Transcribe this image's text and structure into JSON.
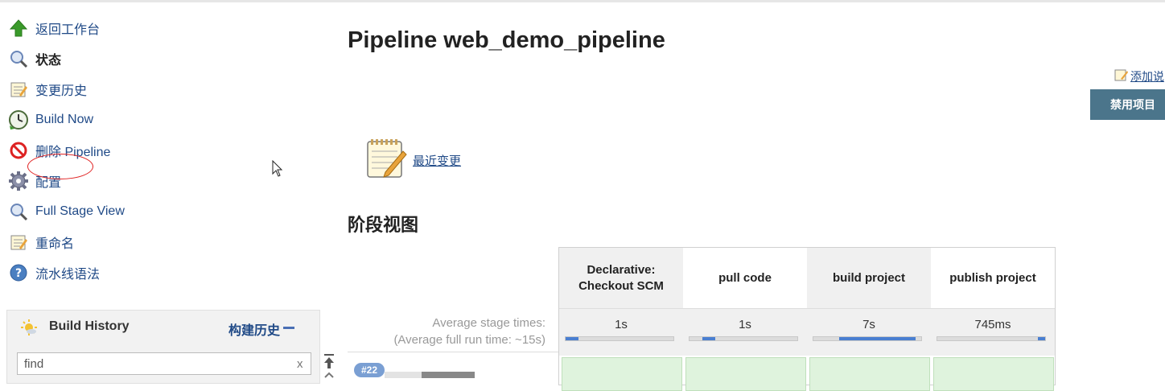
{
  "sidebar": {
    "items": [
      {
        "label": "返回工作台",
        "icon": "up-arrow-icon"
      },
      {
        "label": "状态",
        "icon": "search-icon"
      },
      {
        "label": "变更历史",
        "icon": "notepad-icon"
      },
      {
        "label": "Build Now",
        "icon": "clock-icon"
      },
      {
        "label": "删除 Pipeline",
        "icon": "no-entry-icon"
      },
      {
        "label": "配置",
        "icon": "gear-icon"
      },
      {
        "label": "Full Stage View",
        "icon": "search-icon"
      },
      {
        "label": "重命名",
        "icon": "notepad-icon"
      },
      {
        "label": "流水线语法",
        "icon": "help-icon"
      }
    ]
  },
  "build_history": {
    "title": "Build History",
    "link": "构建历史",
    "search_value": "find",
    "clear": "x"
  },
  "main": {
    "title": "Pipeline web_demo_pipeline",
    "add_description": "添加说",
    "disable_button": "禁用项目",
    "recent_changes": "最近变更",
    "stage_view_title": "阶段视图"
  },
  "stage_view": {
    "avg_label_line1": "Average stage times:",
    "avg_label_line2": "(Average full run time: ~15s)",
    "stages": [
      {
        "name_line1": "Declarative:",
        "name_line2": "Checkout SCM",
        "avg": "1s",
        "progress_start": 0.0,
        "progress_end": 0.12
      },
      {
        "name_line1": "pull code",
        "name_line2": "",
        "avg": "1s",
        "progress_start": 0.12,
        "progress_end": 0.24
      },
      {
        "name_line1": "build project",
        "name_line2": "",
        "avg": "7s",
        "progress_start": 0.24,
        "progress_end": 0.95
      },
      {
        "name_line1": "publish project",
        "name_line2": "",
        "avg": "745ms",
        "progress_start": 0.93,
        "progress_end": 1.0
      }
    ],
    "build_badge": "#22"
  },
  "colors": {
    "link": "#204a87",
    "disable_button_bg": "#4b758b",
    "progress_fill": "#4a7fd1",
    "stage_success_bg": "#dff3dd",
    "annotation_ring": "#e02020"
  }
}
